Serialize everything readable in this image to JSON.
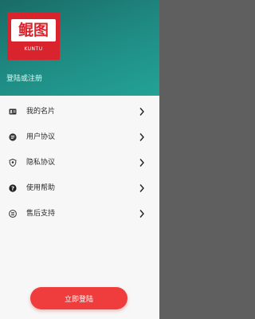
{
  "header": {
    "logo_text": "鲲图",
    "logo_sub": "KUNTU",
    "login_link": "登陆或注册"
  },
  "menu": {
    "items": [
      {
        "label": "我的名片",
        "icon": "id-card-icon"
      },
      {
        "label": "用户协议",
        "icon": "document-icon"
      },
      {
        "label": "隐私协议",
        "icon": "shield-icon"
      },
      {
        "label": "使用帮助",
        "icon": "help-icon"
      },
      {
        "label": "售后支持",
        "icon": "support-icon"
      }
    ]
  },
  "footer": {
    "login_button": "立即登陆"
  },
  "colors": {
    "header_gradient_start": "#1a6b66",
    "header_gradient_end": "#23a295",
    "brand_red": "#d9232d",
    "button_red": "#ee3d3c"
  }
}
